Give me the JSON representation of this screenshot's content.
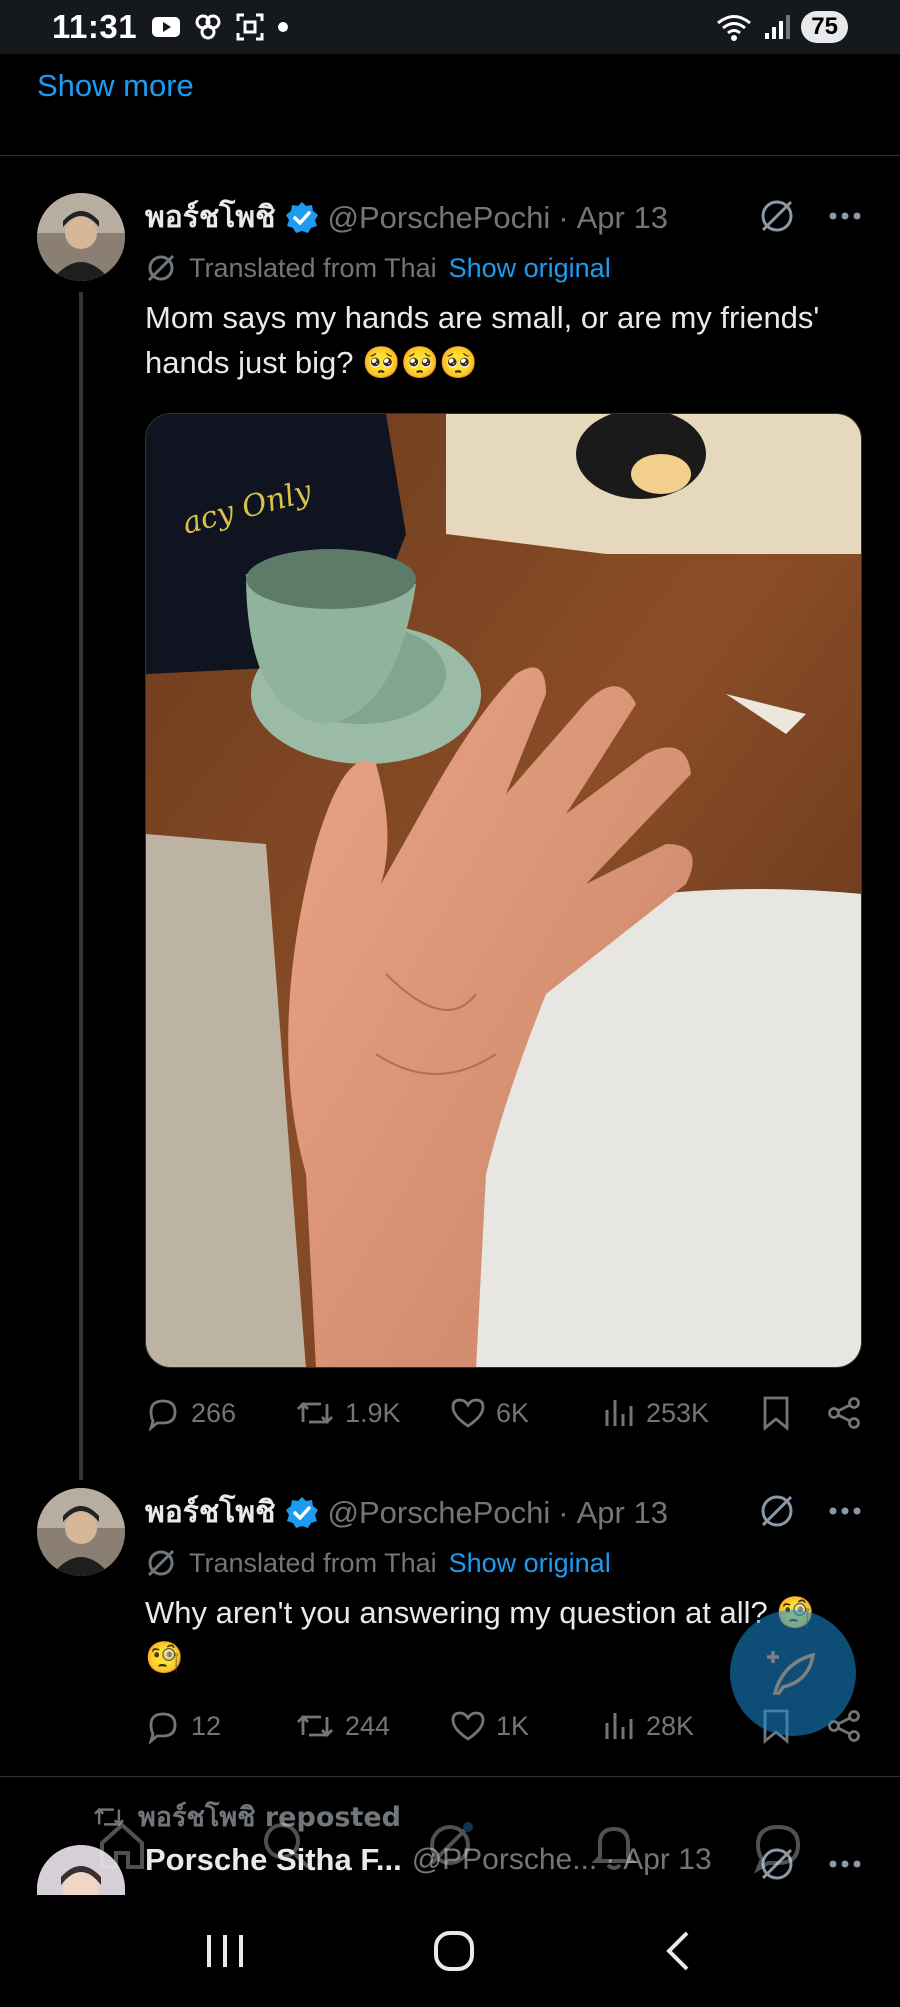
{
  "status_bar": {
    "time": "11:31",
    "battery": "75"
  },
  "show_more": "Show more",
  "tweets": [
    {
      "display_name": "พอร์ชโพชิ",
      "handle": "@PorschePochi",
      "sep": "·",
      "date": "Apr 13",
      "translated_label": "Translated from Thai",
      "show_original": "Show original",
      "text": "Mom says my hands are small, or are my friends' hands just big? 🥺🥺🥺",
      "image_alt": "Two hands pressed together palm to palm over a wooden cafe table with a green coffee cup, a cap and an open book",
      "replies": "266",
      "reposts": "1.9K",
      "likes": "6K",
      "views": "253K"
    },
    {
      "display_name": "พอร์ชโพชิ",
      "handle": "@PorschePochi",
      "sep": "·",
      "date": "Apr 13",
      "translated_label": "Translated from Thai",
      "show_original": "Show original",
      "text": "Why aren't you answering my question at all? 🧐🧐",
      "replies": "12",
      "reposts": "244",
      "likes": "1K",
      "views": "28K"
    }
  ],
  "repost_notice": "พอร์ชโพชิ reposted",
  "third_tweet": {
    "display_name": "Porsche Sitha F...",
    "handle": "@PPorsche...",
    "sep": "·",
    "date": "Apr 13"
  },
  "colors": {
    "accent": "#1d9bf0",
    "background": "#000000",
    "muted": "#71767b",
    "text": "#e7e9ea"
  }
}
